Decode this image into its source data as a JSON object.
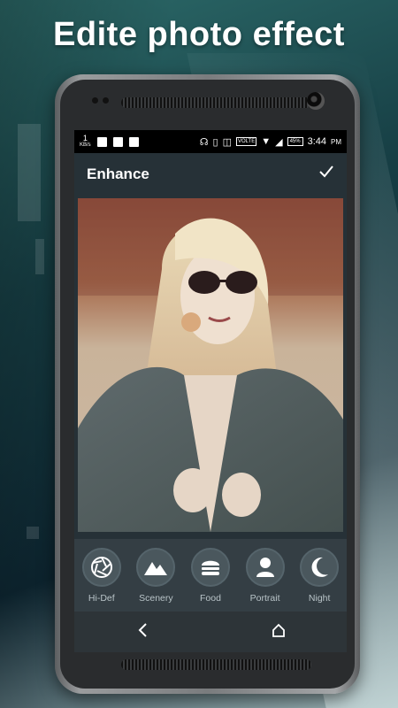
{
  "headline": "Edite photo effect",
  "status_bar": {
    "kbs_value": "1",
    "kbs_unit": "KB/s",
    "volte": "VOLTE",
    "battery": "45%",
    "time": "3:44",
    "ampm": "PM"
  },
  "app_bar": {
    "title": "Enhance",
    "confirm_icon": "checkmark-icon"
  },
  "tools": [
    {
      "label": "Hi-Def",
      "icon": "aperture-icon"
    },
    {
      "label": "Scenery",
      "icon": "mountains-icon"
    },
    {
      "label": "Food",
      "icon": "burger-icon"
    },
    {
      "label": "Portrait",
      "icon": "person-icon"
    },
    {
      "label": "Night",
      "icon": "moon-icon"
    }
  ],
  "nav": {
    "back_icon": "back-chevron-icon",
    "home_icon": "home-icon"
  }
}
